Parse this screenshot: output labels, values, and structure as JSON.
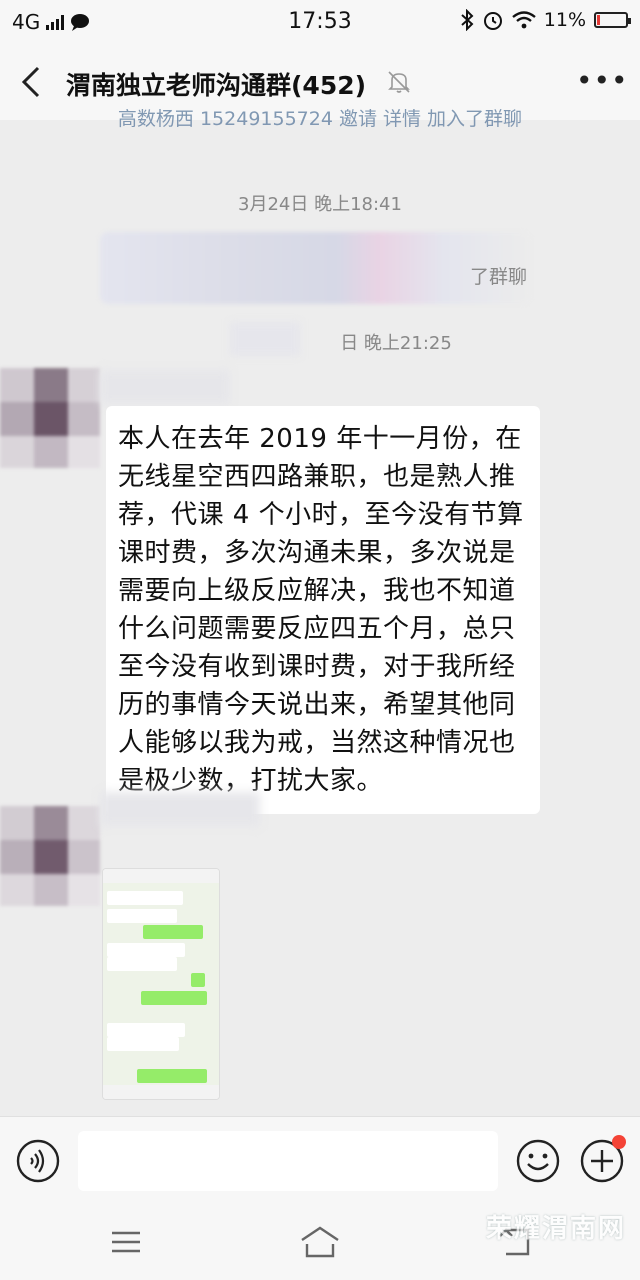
{
  "status_bar": {
    "network": "4G",
    "time": "17:53",
    "battery_pct": "11%",
    "battery_level": 0.11
  },
  "header": {
    "title": "渭南独立老师沟通群(452)"
  },
  "messages": {
    "system_top": "高数杨西 15249155724 邀请 详情 加入了群聊",
    "time_1": "3月24日 晚上18:41",
    "system_blurred_tail": "了群聊",
    "time_2": "日 晚上21:25",
    "text_message": "本人在去年 2019 年十一月份，在无线星空西四路兼职，也是熟人推荐，代课 4 个小时，至今没有节算课时费，多次沟通未果，多次说是需要向上级反应解决，我也不知道什么问题需要反应四五个月，总只至今没有收到课时费，对于我所经历的事情今天说出来，希望其他同人能够以我为戒，当然这种情况也是极少数，打扰大家。"
  },
  "colors": {
    "accent": "#95ec69",
    "badge": "#f44336",
    "link": "#6d89a8"
  },
  "icons": [
    "back-arrow-icon",
    "mute-bell-icon",
    "more-icon",
    "voice-icon",
    "emoji-icon",
    "plus-icon",
    "menu-icon",
    "home-icon",
    "back-nav-icon"
  ],
  "watermark": "荣耀渭南网"
}
